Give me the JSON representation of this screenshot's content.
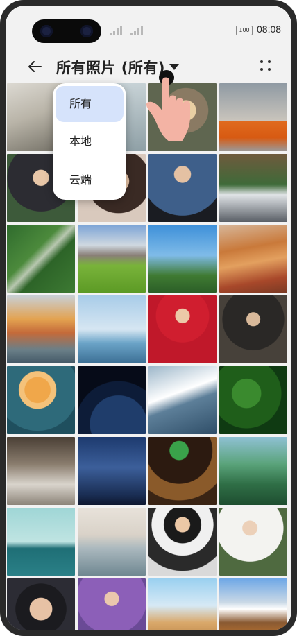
{
  "status_bar": {
    "time": "08:08",
    "battery": "100"
  },
  "header": {
    "title": "所有照片 (所有)"
  },
  "dropdown": {
    "options": [
      {
        "label": "所有",
        "selected": true
      },
      {
        "label": "本地",
        "selected": false
      },
      {
        "label": "云端",
        "selected": false
      }
    ]
  },
  "icons": [
    "back-arrow-icon",
    "dropdown-caret-icon",
    "more-options-icon",
    "signal-icon",
    "battery-icon",
    "tap-hand-icon"
  ],
  "colors": {
    "selected_option_bg": "#d6e3fb",
    "accent": "#3a6fd8",
    "hand": "#f3b3a4"
  }
}
